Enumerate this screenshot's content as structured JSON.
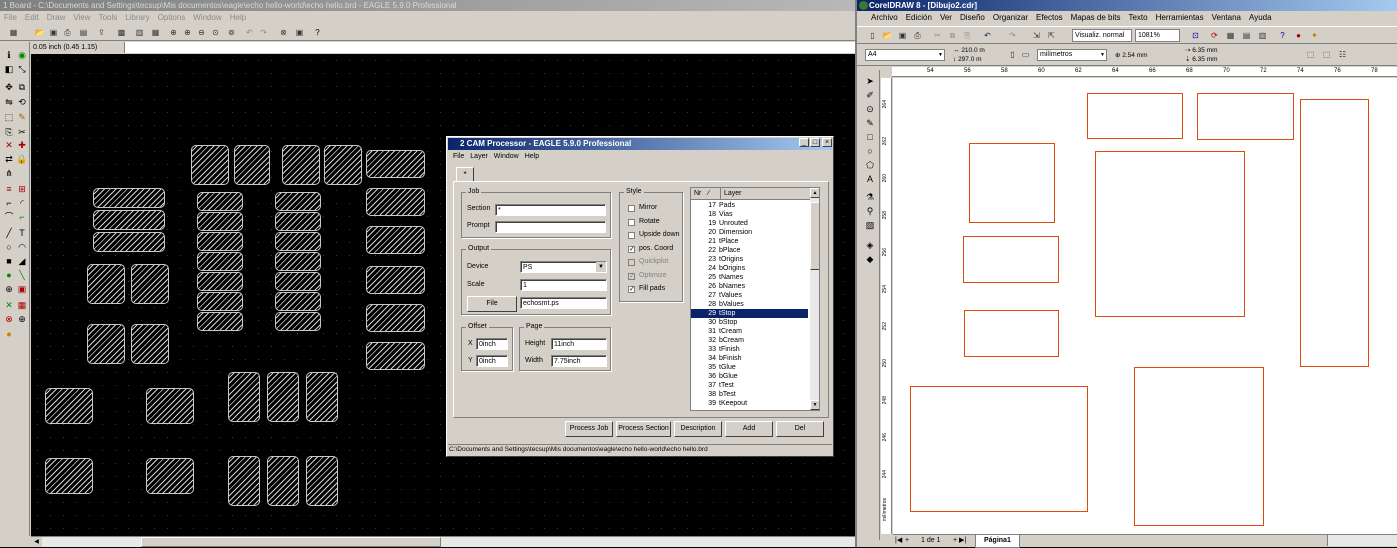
{
  "eagle": {
    "title": "1 Board - C:\\Documents and Settings\\tecsup\\Mis documentos\\eagle\\echo hello-world\\echo hello.brd - EAGLE 5.9.0 Professional",
    "menu": [
      "File",
      "Edit",
      "Draw",
      "View",
      "Tools",
      "Library",
      "Options",
      "Window",
      "Help"
    ],
    "coord": "0.05 inch (0.45 1.15)"
  },
  "cam": {
    "title": "2 CAM Processor - EAGLE 5.9.0 Professional",
    "menu": [
      "File",
      "Layer",
      "Window",
      "Help"
    ],
    "tab": "*",
    "job_group": "Job",
    "section_label": "Section",
    "section_value": "*",
    "prompt_label": "Prompt",
    "prompt_value": "",
    "output_group": "Output",
    "device_label": "Device",
    "device_value": "PS",
    "scale_label": "Scale",
    "scale_value": "1",
    "file_button": "File",
    "file_value": "echosmt.ps",
    "offset_group": "Offset",
    "x_label": "X",
    "x_value": "0inch",
    "y_label": "Y",
    "y_value": "0inch",
    "page_group": "Page",
    "height_label": "Height",
    "height_value": "11inch",
    "width_label": "Width",
    "width_value": "7.75inch",
    "style_group": "Style",
    "style_options": [
      {
        "label": "Mirror",
        "checked": false,
        "enabled": true
      },
      {
        "label": "Rotate",
        "checked": false,
        "enabled": true
      },
      {
        "label": "Upside down",
        "checked": false,
        "enabled": true
      },
      {
        "label": "pos. Coord",
        "checked": true,
        "enabled": true
      },
      {
        "label": "Quickplot",
        "checked": false,
        "enabled": false
      },
      {
        "label": "Optimize",
        "checked": true,
        "enabled": false
      },
      {
        "label": "Fill pads",
        "checked": true,
        "enabled": true
      }
    ],
    "layer_col_nr": "Nr",
    "layer_col_name": "Layer",
    "layers": [
      {
        "nr": "17",
        "name": "Pads"
      },
      {
        "nr": "18",
        "name": "Vias"
      },
      {
        "nr": "19",
        "name": "Unrouted"
      },
      {
        "nr": "20",
        "name": "Dimension"
      },
      {
        "nr": "21",
        "name": "tPlace"
      },
      {
        "nr": "22",
        "name": "bPlace"
      },
      {
        "nr": "23",
        "name": "tOrigins"
      },
      {
        "nr": "24",
        "name": "bOrigins"
      },
      {
        "nr": "25",
        "name": "tNames"
      },
      {
        "nr": "26",
        "name": "bNames"
      },
      {
        "nr": "27",
        "name": "tValues"
      },
      {
        "nr": "28",
        "name": "bValues"
      },
      {
        "nr": "29",
        "name": "tStop"
      },
      {
        "nr": "30",
        "name": "bStop"
      },
      {
        "nr": "31",
        "name": "tCream"
      },
      {
        "nr": "32",
        "name": "bCream"
      },
      {
        "nr": "33",
        "name": "tFinish"
      },
      {
        "nr": "34",
        "name": "bFinish"
      },
      {
        "nr": "35",
        "name": "tGlue"
      },
      {
        "nr": "36",
        "name": "bGlue"
      },
      {
        "nr": "37",
        "name": "tTest"
      },
      {
        "nr": "38",
        "name": "bTest"
      },
      {
        "nr": "39",
        "name": "tKeepout"
      }
    ],
    "selected_layer": "29",
    "buttons": [
      "Process Job",
      "Process Section",
      "Description",
      "Add",
      "Del"
    ],
    "status": "C:\\Documents and Settings\\tecsup\\Mis documentos\\eagle\\echo hello-world\\echo hello.brd"
  },
  "corel": {
    "title": "CorelDRAW 8 - [Dibujo2.cdr]",
    "menu": [
      "Archivo",
      "Edición",
      "Ver",
      "Diseño",
      "Organizar",
      "Efectos",
      "Mapas de bits",
      "Texto",
      "Herramientas",
      "Ventana",
      "Ayuda"
    ],
    "view_mode": "Visualiz. normal",
    "zoom": "1081%",
    "paper": "A4",
    "page_w": "210.0 m",
    "page_h": "297.0 m",
    "units": "milímetros",
    "nudge": "2.54 mm",
    "dup_x": "6.35 mm",
    "dup_y": "6.35 mm",
    "ruler_h": [
      "54",
      "56",
      "58",
      "60",
      "62",
      "64",
      "66",
      "68",
      "70",
      "72",
      "74",
      "76",
      "78"
    ],
    "ruler_v": [
      "264",
      "262",
      "260",
      "258",
      "256",
      "254",
      "252",
      "250",
      "248",
      "246",
      "244"
    ],
    "ruler_unit": "milímetros",
    "page_nav": "1 de 1",
    "page_tab": "Página1"
  }
}
